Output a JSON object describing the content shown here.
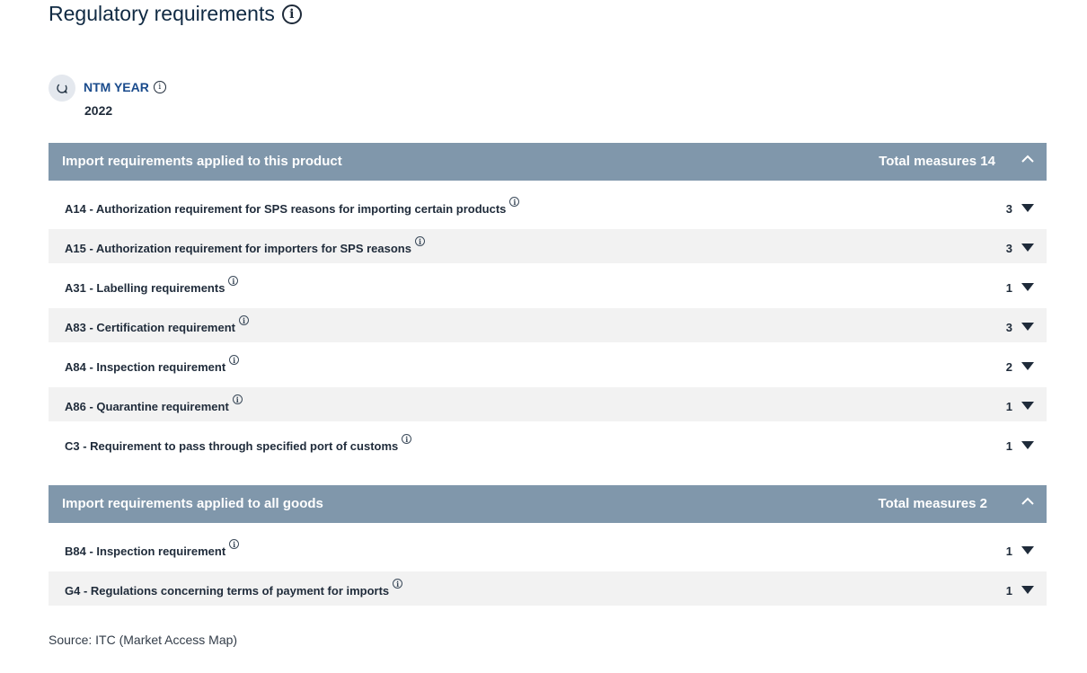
{
  "header": {
    "title": "Regulatory requirements",
    "info_icon": "info-circle-icon"
  },
  "ntm": {
    "label": "NTM YEAR",
    "year": "2022",
    "icon": "loading-icon"
  },
  "sections": [
    {
      "title": "Import requirements applied to this product",
      "total": "Total measures 14",
      "rows": [
        {
          "label": "A14 - Authorization requirement for SPS reasons for importing certain products",
          "count": "3"
        },
        {
          "label": "A15 - Authorization requirement for importers for SPS reasons",
          "count": "3"
        },
        {
          "label": "A31 - Labelling requirements",
          "count": "1"
        },
        {
          "label": "A83 - Certification requirement",
          "count": "3"
        },
        {
          "label": "A84 - Inspection requirement",
          "count": "2"
        },
        {
          "label": "A86 - Quarantine requirement",
          "count": "1"
        },
        {
          "label": "C3 - Requirement to pass through specified port of customs",
          "count": "1"
        }
      ]
    },
    {
      "title": "Import requirements applied to all goods",
      "total": "Total measures 2",
      "rows": [
        {
          "label": "B84 - Inspection requirement",
          "count": "1"
        },
        {
          "label": "G4 - Regulations concerning terms of payment for imports",
          "count": "1"
        }
      ]
    }
  ],
  "source": "Source: ITC (Market Access Map)",
  "colors": {
    "header_bg": "#8097ab",
    "row_shade": "#f2f2f2",
    "accent": "#1a4b8c"
  }
}
